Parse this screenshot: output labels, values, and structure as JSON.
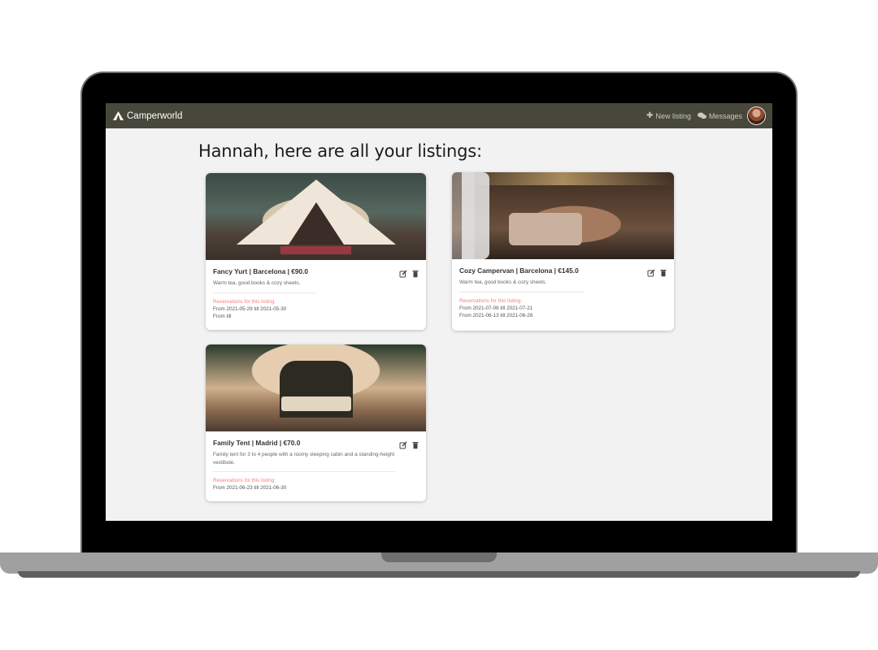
{
  "app": {
    "name": "Camperworld"
  },
  "nav": {
    "new_listing": "New listing",
    "messages": "Messages"
  },
  "page": {
    "title": "Hannah, here are all your listings:"
  },
  "listings": [
    {
      "title": "Fancy Yurt | Barcelona | €90.0",
      "description": "Warm tea, good books & cozy sheets.",
      "reservations_label": "Reservations for this listing:",
      "reservations": [
        "From 2021-05-29 till 2021-05-30",
        "From till"
      ]
    },
    {
      "title": "Cozy Campervan | Barcelona | €145.0",
      "description": "Warm tea, good books & cozy sheets.",
      "reservations_label": "Reservations for this listing:",
      "reservations": [
        "From 2021-07-06 till 2021-07-21",
        "From 2021-06-13 till 2021-06-26"
      ]
    },
    {
      "title": "Family Tent | Madrid | €70.0",
      "description": "Family tent for 3 to 4 people with a roomy sleeping cabin and a standing-height vestibule.",
      "reservations_label": "Reservations for this listing:",
      "reservations": [
        "From 2021-06-23 till 2021-06-30"
      ]
    }
  ],
  "icons": {
    "brand": "tent-icon",
    "new_listing": "plus-icon",
    "messages": "chat-bubbles-icon",
    "edit": "edit-icon",
    "delete": "trash-icon"
  },
  "colors": {
    "navbar": "#47483b",
    "background": "#f2f2f2",
    "reservation_label": "#ff7a7a"
  }
}
